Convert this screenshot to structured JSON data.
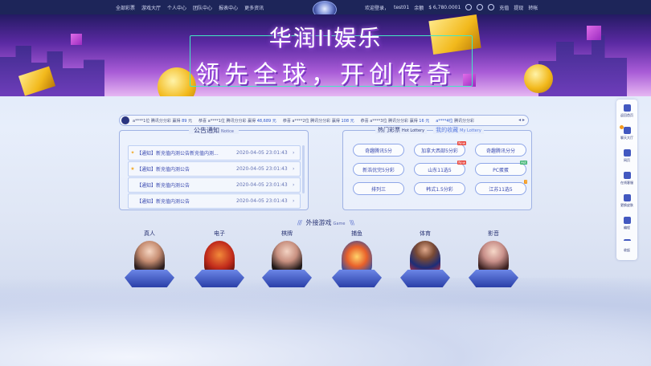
{
  "nav": {
    "links": [
      "全部彩票",
      "游戏大厅",
      "个人中心",
      "团队中心",
      "报表中心",
      "更多资讯"
    ]
  },
  "user": {
    "welcome": "欢迎登录，",
    "username": "test01",
    "balance_label": "余额",
    "balance": "$ 6,780.0001",
    "deposit": "充值",
    "withdraw": "提现",
    "transfer": "转帐"
  },
  "banner": {
    "title_line1": "华润II娱乐",
    "title_line2": "领先全球，开创传奇"
  },
  "ticker": {
    "entries": [
      {
        "user": "a****1位",
        "game": "腾讯分分彩",
        "verb": "赢得",
        "amount": "89",
        "unit": "元"
      },
      {
        "user": "恭喜",
        "game": "a****1位",
        "verb": "腾讯分分彩",
        "amount": "赢得",
        "unit": "48,689 元"
      },
      {
        "user": "恭喜",
        "game": "a****2位",
        "verb": "腾讯分分彩",
        "amount": "赢得",
        "unit": "108 元"
      },
      {
        "user": "恭喜",
        "game": "a****3位",
        "verb": "腾讯分分彩",
        "amount": "赢得",
        "unit": "16 元"
      },
      {
        "user": "a****4位",
        "game": "腾讯分分彩",
        "verb": "",
        "amount": "",
        "unit": ""
      }
    ]
  },
  "notice": {
    "title": "公告通知",
    "title_en": "Notice",
    "rows": [
      {
        "text": "【通知】新充值内测公告新充值内测...",
        "date": "2020-04-05 23:01:43"
      },
      {
        "text": "【通知】新充值内测公告",
        "date": "2020-04-05 23:01:43"
      },
      {
        "text": "【通知】新充值内测公告",
        "date": "2020-04-05 23:01:43"
      },
      {
        "text": "【通知】新充值内测公告",
        "date": "2020-04-05 23:01:43"
      }
    ]
  },
  "lottery": {
    "tab_hot": "热门彩票",
    "tab_hot_en": "Hot Lottery",
    "tab_fav": "我的收藏",
    "tab_fav_en": "My Lottery",
    "items": [
      {
        "name": "奇趣腾讯5分",
        "badge": ""
      },
      {
        "name": "加拿大西部5分彩",
        "badge": "New"
      },
      {
        "name": "奇趣腾讯分分",
        "badge": ""
      },
      {
        "name": "新浩优完5分彩",
        "badge": ""
      },
      {
        "name": "山东11选5",
        "badge": "New"
      },
      {
        "name": "PC蛋蛋",
        "badge": "Hot"
      },
      {
        "name": "排列三",
        "badge": ""
      },
      {
        "name": "韩式1.5分彩",
        "badge": ""
      },
      {
        "name": "江苏11选5",
        "badge": "!"
      }
    ]
  },
  "games": {
    "title": "外接游戏",
    "title_en": "Game",
    "items": [
      "真人",
      "电子",
      "棋牌",
      "捕鱼",
      "体育",
      "影音"
    ]
  },
  "sidebar": {
    "items": [
      "返回首页",
      "聊天大厅",
      "网页",
      "在线客服",
      "更换皮肤",
      "编程",
      "收起"
    ]
  },
  "colors": {
    "nav_bg": "#1d2559",
    "accent": "#3a4ab0",
    "banner_cyan": "#42e8c4",
    "gold": "#f2b91c"
  }
}
